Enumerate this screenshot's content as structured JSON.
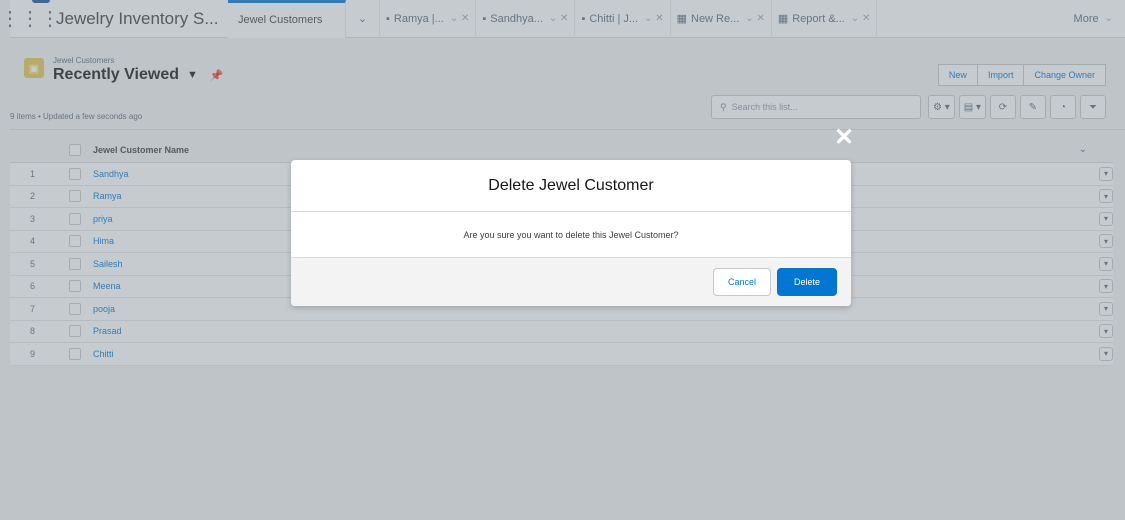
{
  "app": {
    "name": "Jewelry Inventory S..."
  },
  "tabs": [
    {
      "label": "Jewel Customers",
      "active": true
    },
    {
      "label": "Ramya |...",
      "icon": "record-icon"
    },
    {
      "label": "Sandhya...",
      "icon": "record-icon"
    },
    {
      "label": "Chitti | J...",
      "icon": "record-icon"
    },
    {
      "label": "New Re...",
      "icon": "report-icon"
    },
    {
      "label": "Report &...",
      "icon": "report-icon"
    }
  ],
  "more_label": "More",
  "list": {
    "object_label": "Jewel Customers",
    "view_name": "Recently Viewed",
    "meta": "9 items • Updated a few seconds ago",
    "buttons": {
      "new": "New",
      "import": "Import",
      "change_owner": "Change Owner"
    },
    "search_placeholder": "Search this list...",
    "column_header": "Jewel Customer Name",
    "rows": [
      {
        "num": "1",
        "name": "Sandhya"
      },
      {
        "num": "2",
        "name": "Ramya"
      },
      {
        "num": "3",
        "name": "priya"
      },
      {
        "num": "4",
        "name": "Hima"
      },
      {
        "num": "5",
        "name": "Sailesh"
      },
      {
        "num": "6",
        "name": "Meena"
      },
      {
        "num": "7",
        "name": "pooja"
      },
      {
        "num": "8",
        "name": "Prasad"
      },
      {
        "num": "9",
        "name": "Chitti"
      }
    ]
  },
  "modal": {
    "title": "Delete Jewel Customer",
    "message": "Are you sure you want to delete this Jewel Customer?",
    "cancel": "Cancel",
    "delete": "Delete"
  },
  "colors": {
    "brand": "#0176d3",
    "object_icon": "#e4c850"
  }
}
